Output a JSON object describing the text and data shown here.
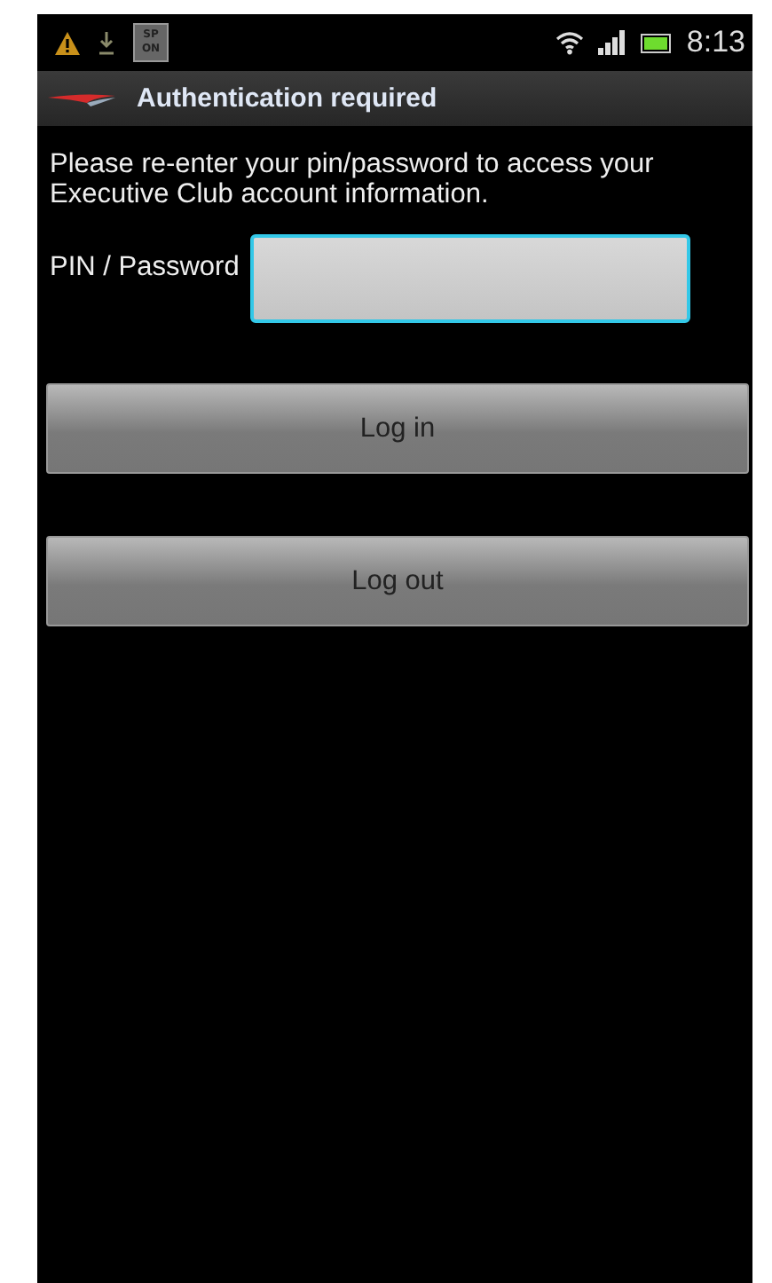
{
  "status_bar": {
    "badge_lines": [
      "SP",
      "ON"
    ],
    "time": "8:13"
  },
  "title_bar": {
    "title": "Authentication required"
  },
  "message": "Please re-enter your pin/password to access your Executive Club account information.",
  "pin_field": {
    "label": "PIN / Password",
    "focused": true
  },
  "buttons": [
    "Log in",
    "Log out"
  ]
}
